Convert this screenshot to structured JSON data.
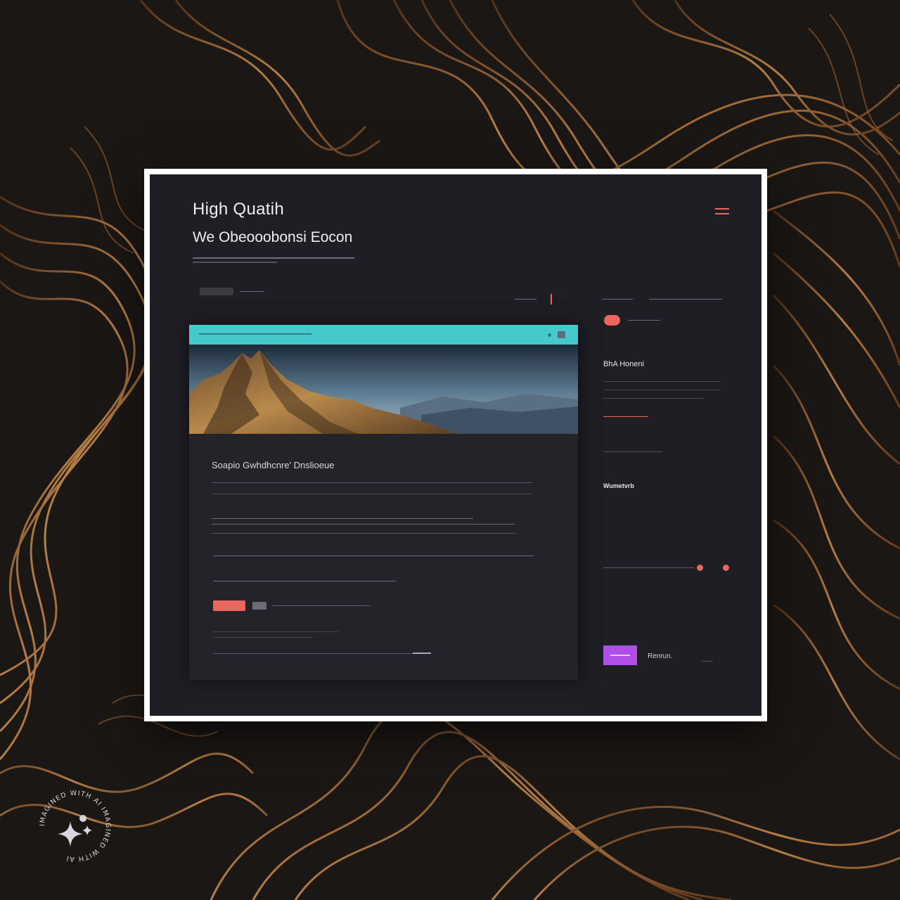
{
  "hero": {
    "title": "High Quatih",
    "subtitle": "We Obeooobonsi Eocon"
  },
  "sidebar": {
    "heading": "BhA Honeni",
    "section_label": "Wumetvrb",
    "purple_button_label": "Renrun."
  },
  "card": {
    "title": "Soapio Gwhdhcnre' Dnslioeue"
  },
  "badge": {
    "text": "IMAGINED WITH AI IMAGINED WITH AI "
  },
  "colors": {
    "accent_coral": "#e8675e",
    "accent_teal": "#46c9cc",
    "accent_purple": "#b04ee8",
    "panel_bg": "#1f1e24",
    "frame": "#ffffff"
  },
  "icons": [
    "hamburger-menu-icon",
    "ai-sparkle-icon"
  ]
}
